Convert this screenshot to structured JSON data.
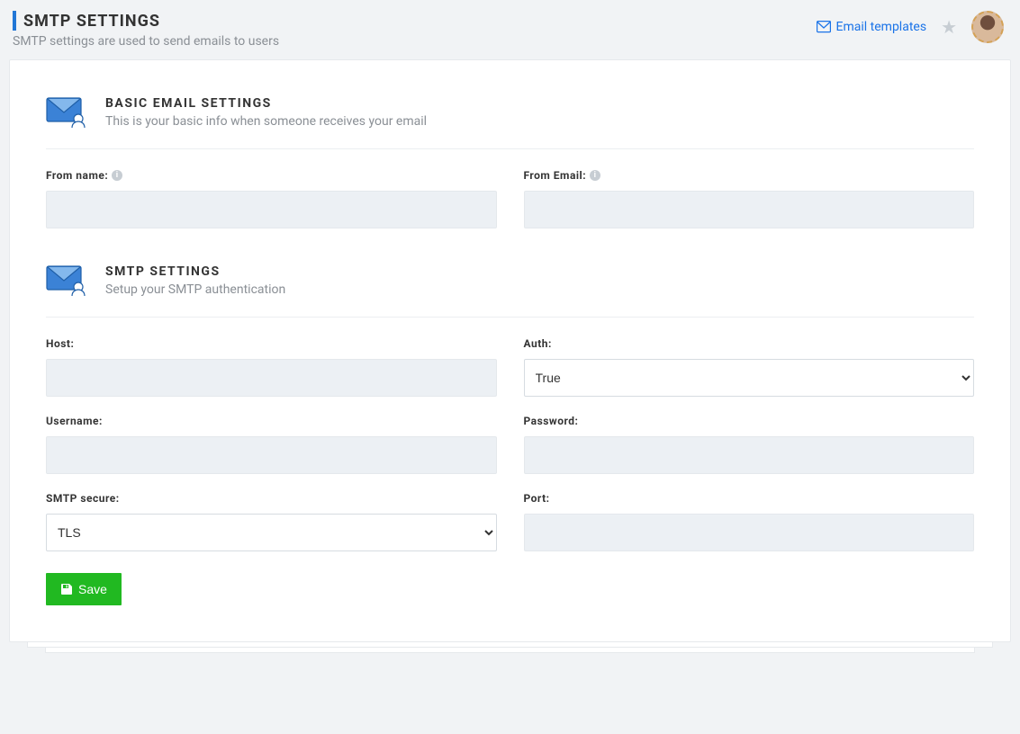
{
  "header": {
    "title": "SMTP SETTINGS",
    "subtitle": "SMTP settings are used to send emails to users",
    "email_templates_link": "Email templates"
  },
  "sections": {
    "basic": {
      "title": "BASIC EMAIL SETTINGS",
      "desc": "This is your basic info when someone receives your email",
      "fields": {
        "from_name": {
          "label": "From name:",
          "value": ""
        },
        "from_email": {
          "label": "From Email:",
          "value": ""
        }
      }
    },
    "smtp": {
      "title": "SMTP SETTINGS",
      "desc": "Setup your SMTP authentication",
      "fields": {
        "host": {
          "label": "Host:",
          "value": ""
        },
        "auth": {
          "label": "Auth:",
          "selected": "True"
        },
        "username": {
          "label": "Username:",
          "value": ""
        },
        "password": {
          "label": "Password:",
          "value": ""
        },
        "smtp_secure": {
          "label": "SMTP secure:",
          "selected": "TLS"
        },
        "port": {
          "label": "Port:",
          "value": ""
        }
      }
    }
  },
  "buttons": {
    "save": "Save"
  }
}
